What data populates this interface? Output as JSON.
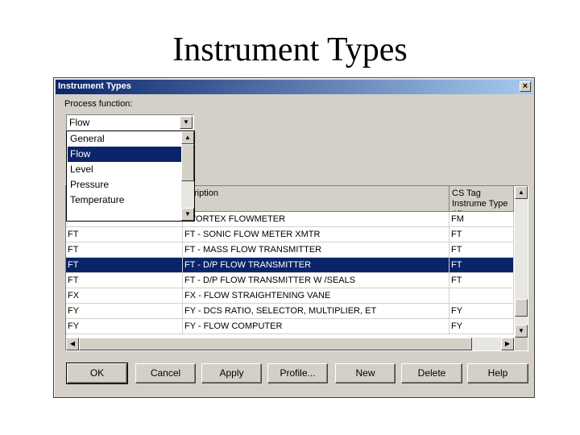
{
  "slide_title": "Instrument Types",
  "dialog": {
    "title": "Instrument Types",
    "close_glyph": "×",
    "process_function_label": "Process function:",
    "process_function_value": "Flow",
    "dropdown_options": [
      "General",
      "Flow",
      "Level",
      "Pressure",
      "Temperature"
    ],
    "dropdown_selected_index": 1,
    "table": {
      "headers": [
        "",
        "scription",
        "CS Tag Instrume Type Alias"
      ],
      "rows": [
        {
          "type": "",
          "description": "- VORTEX FLOWMETER",
          "alias": "FM",
          "selected": false
        },
        {
          "type": "FT",
          "description": "FT - SONIC FLOW METER XMTR",
          "alias": "FT",
          "selected": false
        },
        {
          "type": "FT",
          "description": "FT - MASS FLOW TRANSMITTER",
          "alias": "FT",
          "selected": false
        },
        {
          "type": "FT",
          "description": "FT - D/P FLOW TRANSMITTER",
          "alias": "FT",
          "selected": true
        },
        {
          "type": "FT",
          "description": "FT - D/P FLOW TRANSMITTER W /SEALS",
          "alias": "FT",
          "selected": false
        },
        {
          "type": "FX",
          "description": "FX - FLOW STRAIGHTENING VANE",
          "alias": "",
          "selected": false
        },
        {
          "type": "FY",
          "description": "FY - DCS RATIO, SELECTOR, MULTIPLIER, ET",
          "alias": "FY",
          "selected": false
        },
        {
          "type": "FY",
          "description": "FY - FLOW COMPUTER",
          "alias": "FY",
          "selected": false
        }
      ]
    },
    "buttons": {
      "ok": "OK",
      "cancel": "Cancel",
      "apply": "Apply",
      "profile": "Profile...",
      "new": "New",
      "delete": "Delete",
      "help": "Help"
    }
  },
  "colors": {
    "selection": "#0a246a",
    "dialog_face": "#d4d0c8"
  }
}
